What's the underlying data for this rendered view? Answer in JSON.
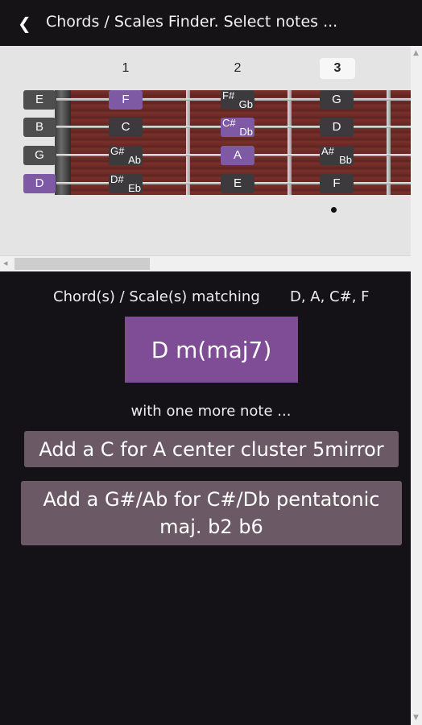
{
  "header": {
    "back_icon": "chevron-left-icon",
    "title": "Chords / Scales Finder. Select notes ..."
  },
  "fretboard": {
    "fret_numbers": [
      "1",
      "2",
      "3"
    ],
    "active_fret": "3",
    "open_strings": [
      "E",
      "B",
      "G",
      "D"
    ],
    "selected_open": "D",
    "fret1": [
      "F",
      "C",
      "G#",
      "D#"
    ],
    "fret1_alt": [
      "",
      "",
      "Ab",
      "Eb"
    ],
    "fret2": [
      "F#",
      "C#",
      "A",
      "E"
    ],
    "fret2_alt": [
      "Gb",
      "Db",
      "",
      ""
    ],
    "fret3": [
      "G",
      "D",
      "A#",
      "F"
    ],
    "fret3_alt": [
      "",
      "",
      "Bb",
      ""
    ],
    "marker_fret": "3"
  },
  "results": {
    "label": "Chord(s) / Scale(s) matching",
    "notes": "D, A, C#, F",
    "chord": "D m(maj7)",
    "more_label": "with one more note ...",
    "suggestions": [
      "Add a C for A center cluster 5mirror",
      "Add a G#/Ab for C#/Db pentatonic maj. b2 b6"
    ]
  },
  "colors": {
    "accent": "#7f4d95",
    "selected_note": "#7f5aa4",
    "suggestion_bg": "#6c5966",
    "background": "#141217"
  }
}
